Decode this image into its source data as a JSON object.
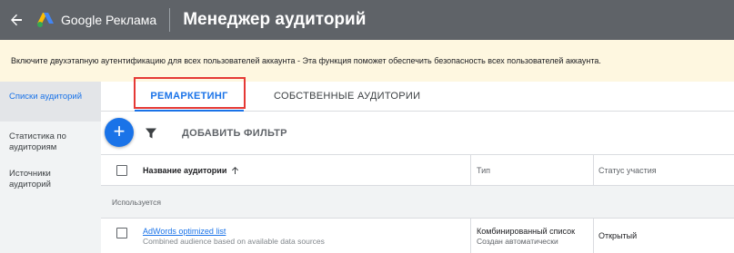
{
  "header": {
    "brand": "Google Реклама",
    "title": "Менеджер аудиторий"
  },
  "banner": {
    "text": "Включите двухэтапную аутентификацию для всех пользователей аккаунта - Эта функция поможет обеспечить безопасность всех пользователей аккаунта."
  },
  "sidebar": {
    "items": [
      {
        "label": "Списки аудиторий"
      },
      {
        "label": "Статистика по аудиториям"
      },
      {
        "label": "Источники аудиторий"
      }
    ]
  },
  "tabs": [
    {
      "label": "РЕМАРКЕТИНГ"
    },
    {
      "label": "СОБСТВЕННЫЕ АУДИТОРИИ"
    }
  ],
  "toolbar": {
    "add_label": "+",
    "add_filter": "ДОБАВИТЬ ФИЛЬТР"
  },
  "table": {
    "columns": [
      "Название аудитории",
      "Тип",
      "Статус участия"
    ],
    "group_label": "Используется",
    "rows": [
      {
        "name": "AdWords optimized list",
        "description": "Combined audience based on available data sources",
        "type": "Комбинированный список",
        "type_sub": "Создан автоматически",
        "status": "Открытый"
      }
    ]
  },
  "colors": {
    "topbar": "#5f6368",
    "accent": "#1a73e8",
    "banner": "#fef7e0",
    "highlight": "#e53935"
  }
}
